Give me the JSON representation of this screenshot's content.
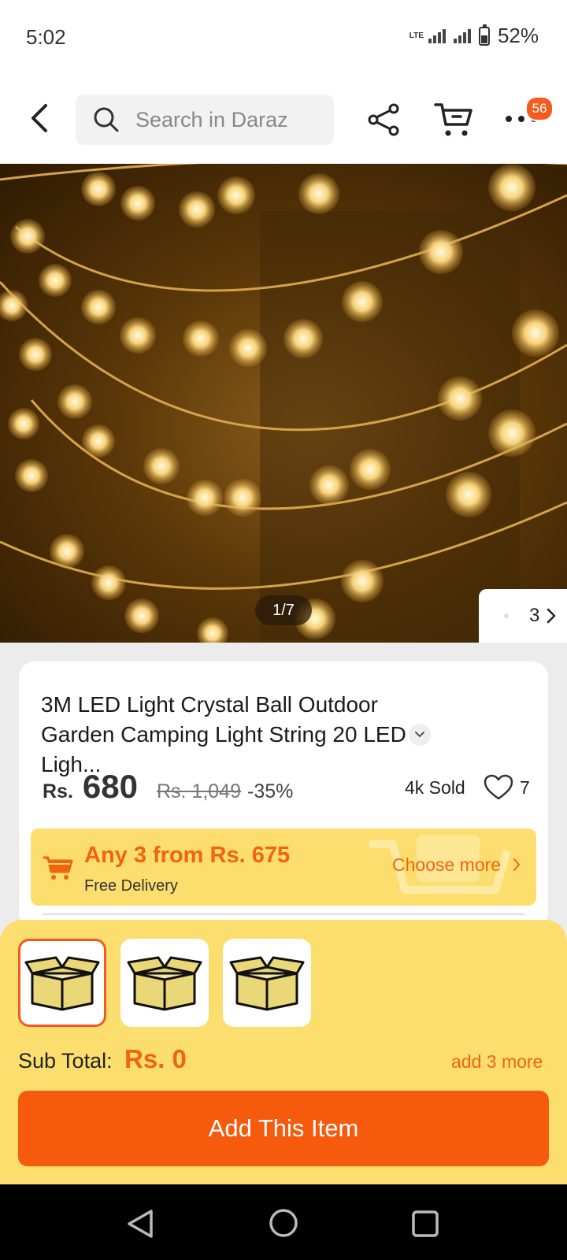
{
  "status_bar": {
    "time": "5:02",
    "network": "LTE",
    "battery": "52%"
  },
  "header": {
    "search_placeholder": "Search in Daraz",
    "notification_count": "56"
  },
  "gallery": {
    "counter": "1/7",
    "thumb_count": "3"
  },
  "product": {
    "title": "3M LED Light Crystal Ball Outdoor Garden Camping Light String 20 LED Ligh...",
    "currency": "Rs.",
    "price": "680",
    "old_price": "Rs. 1,049",
    "discount": "-35%",
    "sold": "4k Sold",
    "likes": "7"
  },
  "promo": {
    "title": "Any 3 from Rs. 675",
    "subtitle": "Free Delivery",
    "choose_more": "Choose more"
  },
  "bundle": {
    "slots": [
      {
        "selected": true
      },
      {
        "selected": false
      },
      {
        "selected": false
      }
    ],
    "subtotal_label": "Sub Total:",
    "subtotal_value": "Rs. 0",
    "add_more": "add 3 more",
    "add_button": "Add This Item"
  },
  "colors": {
    "accent": "#f65a0c",
    "promo_bg": "#fcde6f",
    "badge": "#f55a1e"
  }
}
